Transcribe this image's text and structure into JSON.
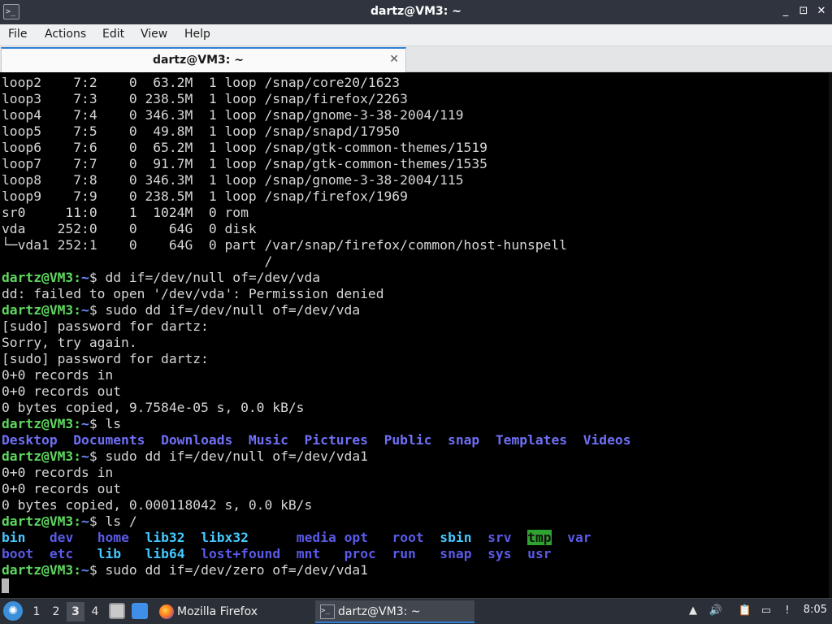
{
  "window": {
    "title": "dartz@VM3: ~",
    "controls": {
      "minimize": "_",
      "maximize": "⊡",
      "close": "✕"
    }
  },
  "menu": [
    "File",
    "Actions",
    "Edit",
    "View",
    "Help"
  ],
  "tab": {
    "label": "dartz@VM3: ~",
    "close": "✕"
  },
  "terminal": {
    "lsblk_rows": [
      "loop2    7:2    0  63.2M  1 loop /snap/core20/1623",
      "loop3    7:3    0 238.5M  1 loop /snap/firefox/2263",
      "loop4    7:4    0 346.3M  1 loop /snap/gnome-3-38-2004/119",
      "loop5    7:5    0  49.8M  1 loop /snap/snapd/17950",
      "loop6    7:6    0  65.2M  1 loop /snap/gtk-common-themes/1519",
      "loop7    7:7    0  91.7M  1 loop /snap/gtk-common-themes/1535",
      "loop8    7:8    0 346.3M  1 loop /snap/gnome-3-38-2004/115",
      "loop9    7:9    0 238.5M  1 loop /snap/firefox/1969",
      "sr0     11:0    1  1024M  0 rom",
      "vda    252:0    0    64G  0 disk",
      "└─vda1 252:1    0    64G  0 part /var/snap/firefox/common/host-hunspell",
      "                                 /"
    ],
    "prompt_user": "dartz@VM3",
    "prompt_sep": ":",
    "prompt_path": "~",
    "prompt_dollar": "$ ",
    "cmd1": "dd if=/dev/null of=/dev/vda",
    "out1": "dd: failed to open '/dev/vda': Permission denied",
    "cmd2": "sudo dd if=/dev/null of=/dev/vda",
    "out2": [
      "[sudo] password for dartz:",
      "Sorry, try again.",
      "[sudo] password for dartz:",
      "0+0 records in",
      "0+0 records out",
      "0 bytes copied, 9.7584e-05 s, 0.0 kB/s"
    ],
    "cmd3": "ls",
    "home_dirs": [
      "Desktop",
      "Documents",
      "Downloads",
      "Music",
      "Pictures",
      "Public",
      "snap",
      "Templates",
      "Videos"
    ],
    "cmd4": "sudo dd if=/dev/null of=/dev/vda1",
    "out4": [
      "0+0 records in",
      "0+0 records out",
      "0 bytes copied, 0.000118042 s, 0.0 kB/s"
    ],
    "cmd5": "ls /",
    "root_row1": [
      "bin",
      "dev",
      "home",
      "lib32",
      "libx32",
      "media",
      "opt",
      "root",
      "sbin",
      "srv",
      "tmp",
      "var"
    ],
    "root_row2": [
      "boot",
      "etc",
      "lib",
      "lib64",
      "lost+found",
      "mnt",
      "proc",
      "run",
      "snap",
      "sys",
      "usr"
    ],
    "cmd6": "sudo dd if=/dev/zero of=/dev/vda1"
  },
  "taskbar": {
    "workspaces": [
      "1",
      "2",
      "3",
      "4"
    ],
    "active_workspace": "3",
    "tasks": [
      {
        "label": "Mozilla Firefox",
        "icon": "firefox-icon"
      },
      {
        "label": "dartz@VM3: ~",
        "icon": "terminal-icon"
      }
    ],
    "clock": "8:05"
  },
  "colors": {
    "prompt_green": "#5fd75f",
    "dir_blue": "#6f6ff7",
    "link_cyan": "#45c9ff",
    "sticky_bg": "#2fa32f"
  }
}
